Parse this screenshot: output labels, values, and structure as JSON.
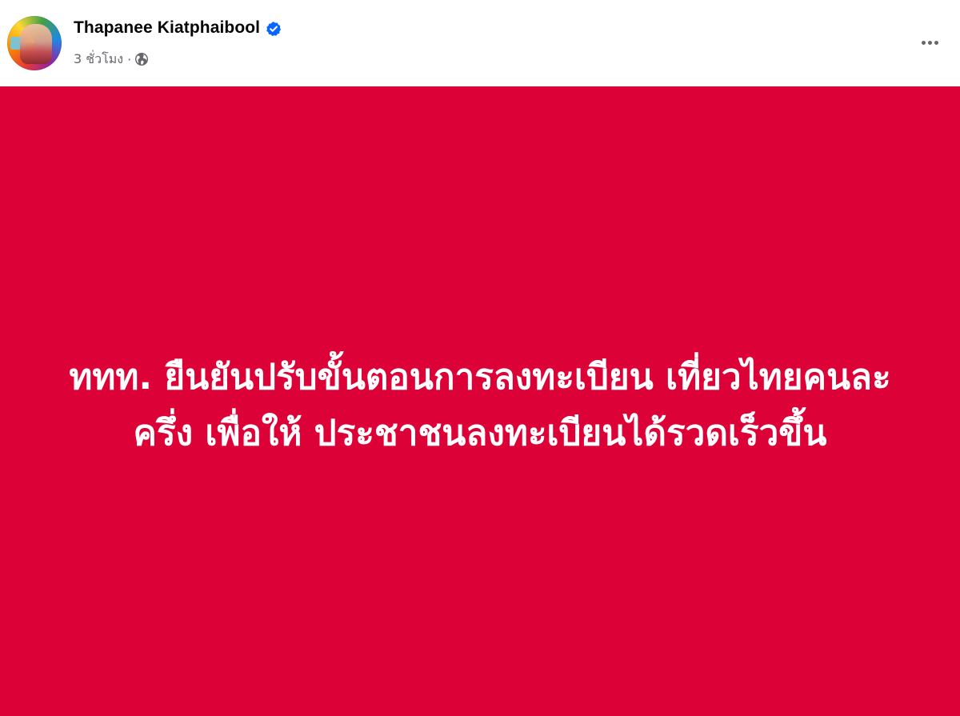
{
  "post": {
    "author": {
      "name": "Thapanee Kiatphaibool",
      "verified_icon": "verified-badge-icon",
      "avatar_icon": "profile-photo"
    },
    "meta": {
      "time": "3 ชั่วโมง",
      "separator": "·",
      "privacy_icon": "globe-icon"
    },
    "more_icon": "more-options-icon",
    "card": {
      "background_color": "#dc0238",
      "text_color": "#ffffff",
      "text": "ททท. ยืนยันปรับขั้นตอนการลงทะเบียน เที่ยวไทยคนละครึ่ง เพื่อให้ ประชาชนลงทะเบียนได้รวดเร็วขึ้น"
    }
  }
}
